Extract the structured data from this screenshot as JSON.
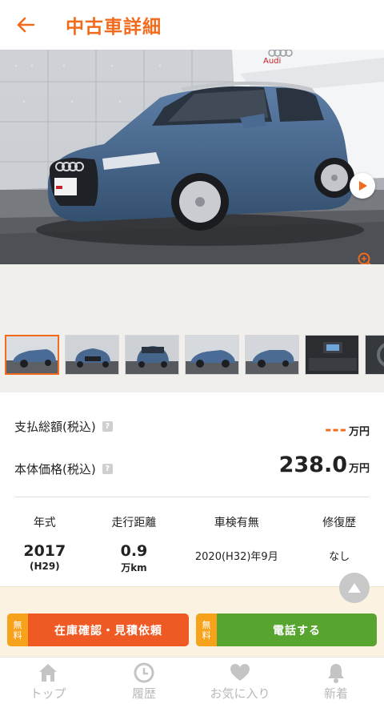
{
  "header": {
    "title": "中古車詳細",
    "back_icon": "arrow-left-icon"
  },
  "hero": {
    "brand_text": "Audi",
    "play_icon": "play-icon",
    "zoom_icon": "zoom-icon"
  },
  "thumbnails": [
    "thumb-1",
    "thumb-2",
    "thumb-3",
    "thumb-4",
    "thumb-5",
    "thumb-6",
    "thumb-7"
  ],
  "price": {
    "total_label": "支払総額(税込)",
    "total_value": "---",
    "total_unit": "万円",
    "body_label": "本体価格(税込)",
    "body_value": "238.0",
    "body_unit": "万円",
    "help": "?"
  },
  "specs": {
    "year": {
      "label": "年式",
      "value": "2017",
      "sub": "(H29)"
    },
    "mileage": {
      "label": "走行距離",
      "value": "0.9",
      "sub": "万km"
    },
    "inspection": {
      "label": "車検有無",
      "value": "2020(H32)年9月"
    },
    "repair": {
      "label": "修復歴",
      "value": "なし"
    }
  },
  "cta": {
    "free_label_top": "無",
    "free_label_bottom": "料",
    "inquiry": "在庫確認・見積依頼",
    "call": "電話する"
  },
  "tabs": [
    {
      "label": "トップ",
      "icon": "home-icon"
    },
    {
      "label": "履歴",
      "icon": "clock-icon"
    },
    {
      "label": "お気に入り",
      "icon": "heart-icon"
    },
    {
      "label": "新着",
      "icon": "bell-icon"
    }
  ],
  "colors": {
    "accent": "#f26b1d",
    "green": "#57a42f",
    "free": "#f7a21b",
    "car": "#4a6b95"
  }
}
